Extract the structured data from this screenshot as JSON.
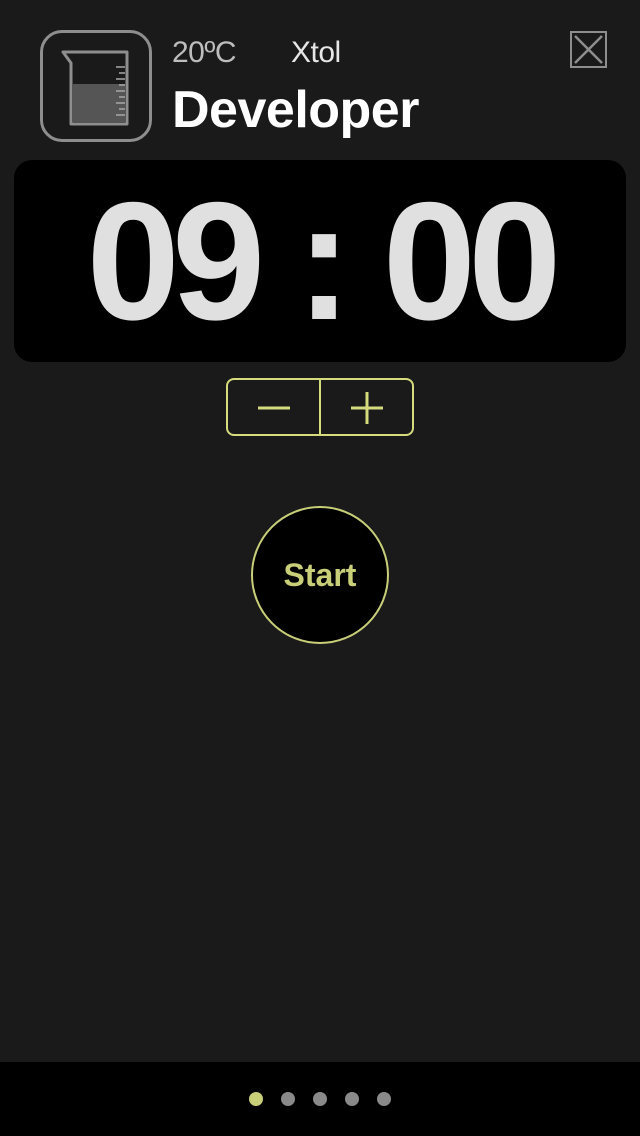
{
  "header": {
    "temperature": "20ºC",
    "chemical": "Xtol",
    "title": "Developer",
    "step_icon": "beaker-icon",
    "close_icon": "close-icon"
  },
  "timer": {
    "display": "09 : 00",
    "minus_icon": "minus-icon",
    "plus_icon": "plus-icon"
  },
  "start_button": {
    "label": "Start"
  },
  "pagination": {
    "total": 5,
    "active_index": 0,
    "active_color": "#c8cf78",
    "inactive_color": "#8a8a8a"
  },
  "colors": {
    "background": "#1a1a1a",
    "accent": "#d4dc7e",
    "timer_text": "#e0e0e0"
  }
}
